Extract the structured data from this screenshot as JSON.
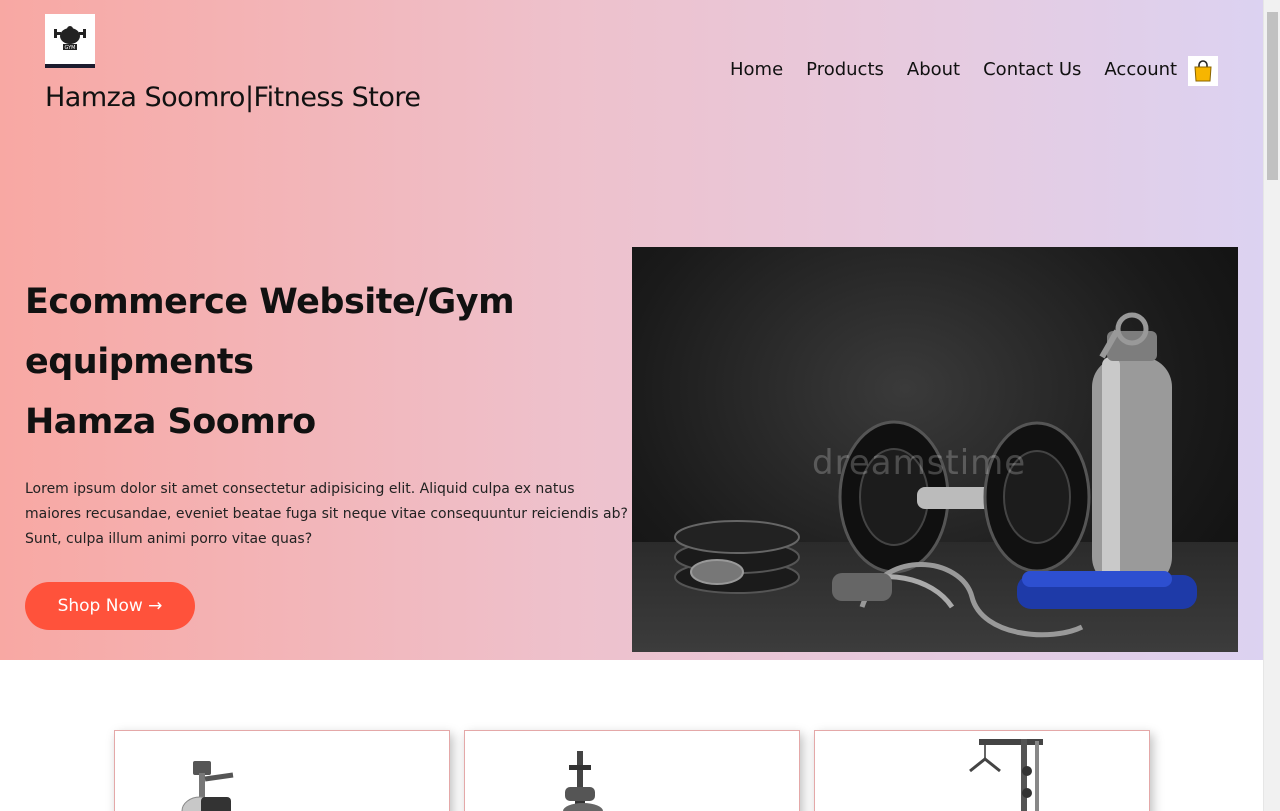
{
  "header": {
    "logo_icon": "gym-logo-icon",
    "brand": "Hamza Soomro|Fitness Store",
    "nav": [
      {
        "label": "Home"
      },
      {
        "label": "Products"
      },
      {
        "label": "About"
      },
      {
        "label": "Contact Us"
      },
      {
        "label": "Account"
      }
    ],
    "cart_icon": "shopping-bag-icon"
  },
  "hero": {
    "headline_line1": "Ecommerce Website/Gym",
    "headline_line2": "equipments",
    "headline_line3": "Hamza Soomro",
    "description": "Lorem ipsum dolor sit amet consectetur adipisicing elit. Aliquid culpa ex natus maiores recusandae, eveniet beatae fuga sit neque vitae consequuntur reiciendis ab? Sunt, culpa illum animi porro vitae quas?",
    "cta_label": "Shop Now →",
    "image_watermark": "dreamstime",
    "accent_color": "#ff523b"
  },
  "products": [
    {
      "icon": "exercise-bike-icon"
    },
    {
      "icon": "weight-bench-icon"
    },
    {
      "icon": "cable-machine-icon"
    }
  ]
}
